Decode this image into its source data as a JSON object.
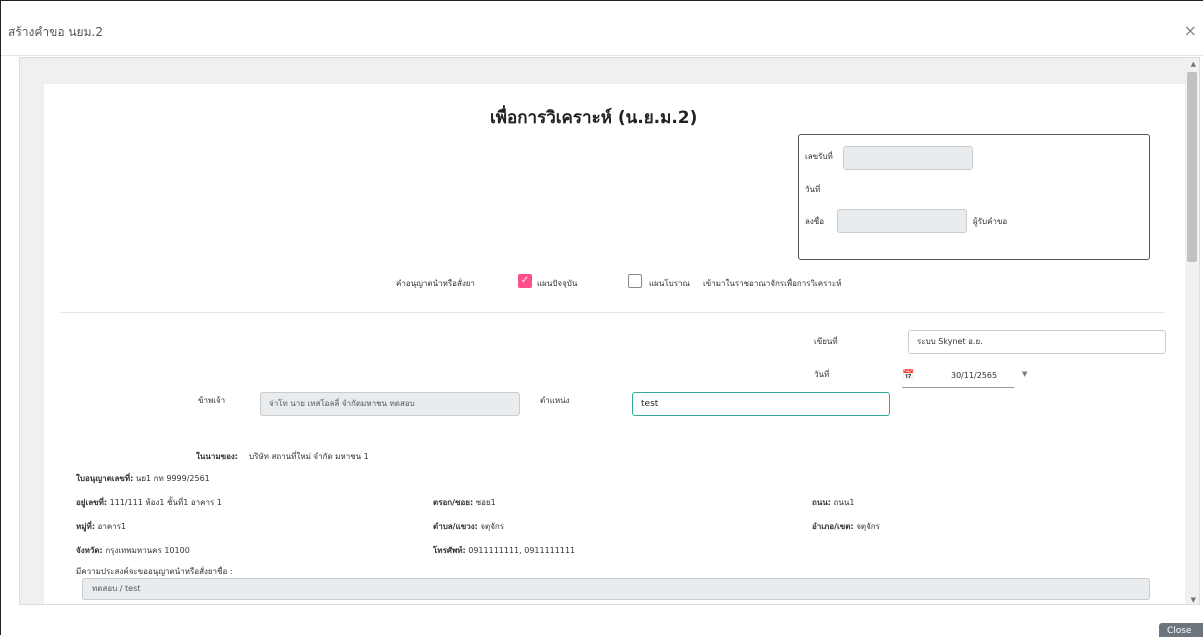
{
  "modal": {
    "title": "สร้างคำขอ นยม.2",
    "close_glyph": "×",
    "footer_close_label": "Close"
  },
  "document": {
    "title": "เพื่อการวิเคราะห์ (น.ย.ม.2)",
    "receipt": {
      "receipt_no_label": "เลขรับที่",
      "receipt_no_value": "",
      "date_label": "วันที่",
      "sign_label": "ลงชื่อ",
      "sign_value": "",
      "receiver_label": "ผู้รับคำขอ"
    },
    "license_type": {
      "prefix_label": "คำอนุญาตนำหรือสั่งยา",
      "option_current_label": "แผนปัจจุบัน",
      "option_current_checked": true,
      "option_traditional_label": "แผนโบราณ",
      "option_traditional_checked": false,
      "suffix_label": "เข้ามาในราชอาณาจักรเพื่อการวิเคราะห์"
    },
    "written_at": {
      "label": "เขียนที่",
      "value": "ระบบ Skynet อ.ย."
    },
    "date": {
      "label": "วันที่",
      "value": "30/11/2565"
    },
    "applicant": {
      "label": "ข้าพเจ้า",
      "value": "จ่าโท นาย เทสโอลลี่ จำกัดมหาชน ทดสอบ",
      "position_label": "ตำแหน่ง",
      "position_value": "test"
    },
    "on_behalf": {
      "label": "ในนามของ:",
      "value": "บริษัท สถานที่ใหม่ จำกัด มหาชน 1"
    },
    "license_no": {
      "label": "ใบอนุญาตเลขที่:",
      "value": "นย1 กท 9999/2561"
    },
    "address": {
      "no_label": "อยู่เลขที่:",
      "no_value": "111/111 ห้อง1 ชั้นที่1 อาคาร 1",
      "alley_label": "ตรอก/ซอย:",
      "alley_value": "ซอย1",
      "road_label": "ถนน:",
      "road_value": "ถนน1",
      "moo_label": "หมู่ที่:",
      "moo_value": "อาคาร1",
      "subdistrict_label": "ตำบล/แขวง:",
      "subdistrict_value": "จตุจักร",
      "district_label": "อำเภอ/เขต:",
      "district_value": "จตุจักร",
      "province_label": "จังหวัด:",
      "province_value": "กรุงเทพมหานคร 10100",
      "phone_label": "โทรศัพท์:",
      "phone_value": "0911111111, 0911111111"
    },
    "purpose": {
      "label": "มีความประสงค์จะขออนุญาตนำหรือสั่งยาชื่อ :",
      "value": "ทดสอบ / test"
    }
  },
  "colors": {
    "checkbox_checked": "#ff4f8b",
    "focus_border": "#2eaa9a",
    "disabled_bg": "#e9ecef"
  }
}
